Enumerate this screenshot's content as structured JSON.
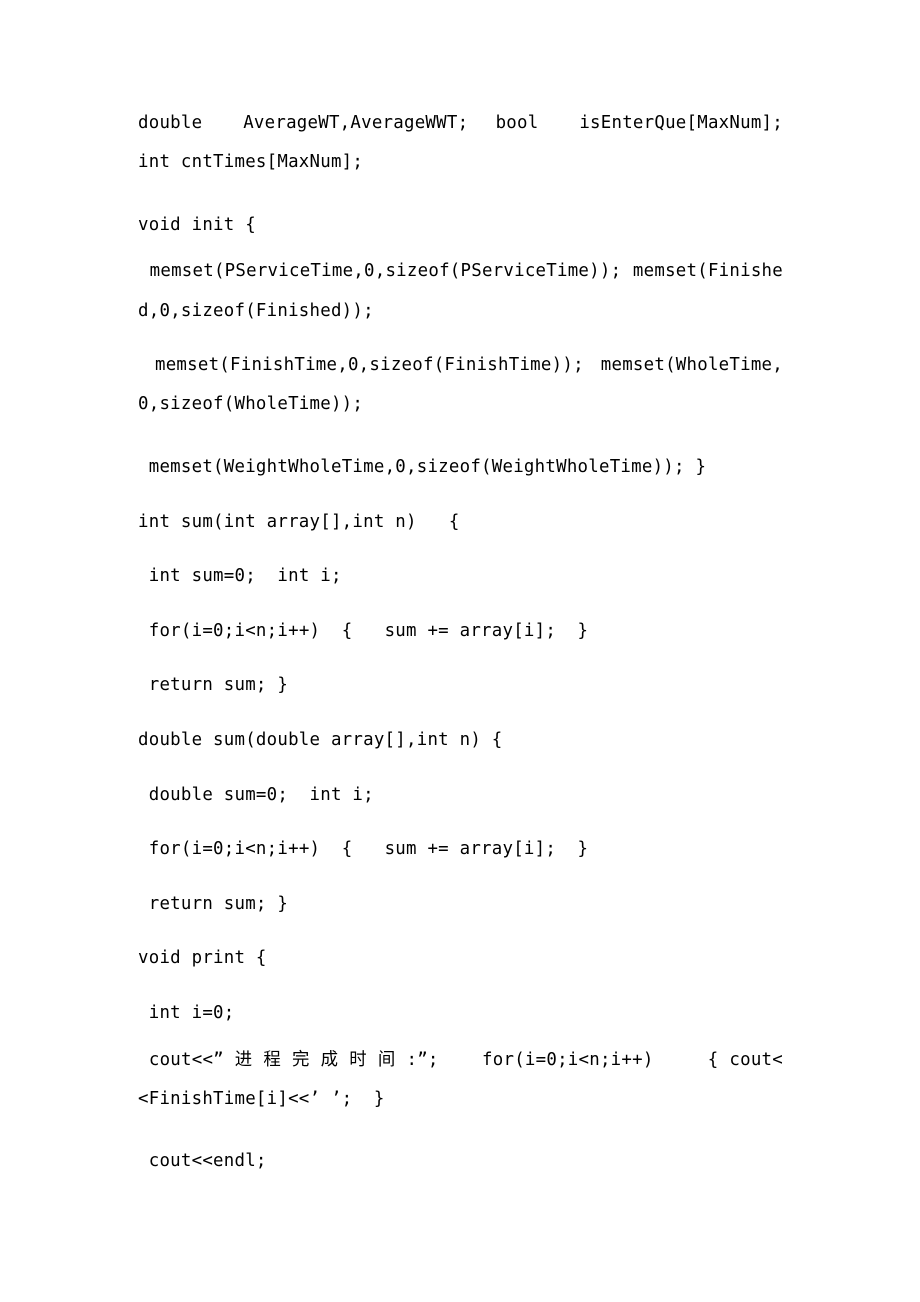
{
  "document": {
    "page_background": "#ffffff",
    "text_color": "#000000",
    "language": "C++ source code with Simplified Chinese string literal",
    "lines": [
      {
        "id": "declarations",
        "wrapped": true,
        "text": "double   AverageWT,AverageWWT;  bool   isEnterQue[MaxNum];  int cntTimes[MaxNum];"
      },
      {
        "id": "void-init-open",
        "wrapped": false,
        "text": "void init {"
      },
      {
        "id": "memset-pservicetime-finished",
        "wrapped": true,
        "text": " memset(PServiceTime,0,sizeof(PServiceTime)); memset(Finished,0,sizeof(Finished));"
      },
      {
        "id": "memset-finishtime-wholetime",
        "wrapped": true,
        "text": " memset(FinishTime,0,sizeof(FinishTime)); memset(WholeTime,0,sizeof(WholeTime));"
      },
      {
        "id": "memset-weightwholetime",
        "wrapped": false,
        "text": " memset(WeightWholeTime,0,sizeof(WeightWholeTime)); }"
      },
      {
        "id": "int-sum-signature",
        "wrapped": false,
        "text": "int sum(int array[],int n)   {"
      },
      {
        "id": "int-sum-locals",
        "wrapped": false,
        "text": " int sum=0;  int i;"
      },
      {
        "id": "int-sum-for-loop",
        "wrapped": false,
        "text": " for(i=0;i<n;i++)  {   sum += array[i];  }"
      },
      {
        "id": "int-sum-return",
        "wrapped": false,
        "text": " return sum; }"
      },
      {
        "id": "double-sum-signature",
        "wrapped": false,
        "text": "double sum(double array[],int n) {"
      },
      {
        "id": "double-sum-locals",
        "wrapped": false,
        "text": " double sum=0;  int i;"
      },
      {
        "id": "double-sum-for-loop",
        "wrapped": false,
        "text": " for(i=0;i<n;i++)  {   sum += array[i];  }"
      },
      {
        "id": "double-sum-return",
        "wrapped": false,
        "text": " return sum; }"
      },
      {
        "id": "void-print-open",
        "wrapped": false,
        "text": "void print {"
      },
      {
        "id": "print-local-i",
        "wrapped": false,
        "text": " int i=0;"
      },
      {
        "id": "print-finishtime-loop",
        "wrapped": true,
        "text": " cout<<” 进 程 完 成 时 间 :”;    for(i=0;i<n;i++)     { cout<<FinishTime[i]<<’ ’;  }"
      },
      {
        "id": "print-endl",
        "wrapped": false,
        "text": " cout<<endl;"
      }
    ]
  }
}
